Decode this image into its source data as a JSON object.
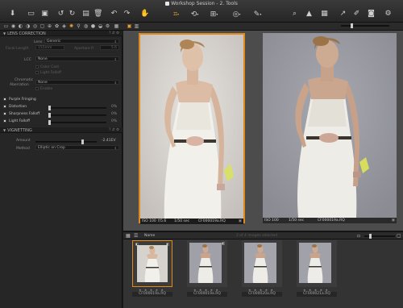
{
  "window": {
    "title": "Workshop Session - 2. Tools"
  },
  "toolbar": {
    "icons": [
      "import-icon",
      "camera-icon",
      "folder-icon",
      "rotate-left-icon",
      "rotate-right-icon",
      "copy-icon",
      "trash-icon",
      "undo-icon",
      "redo-icon",
      "hand-icon",
      "crop-icon",
      "rotate-icon",
      "keystone-icon",
      "spot-icon",
      "eyedropper-icon",
      "magnifier-icon",
      "warning-icon",
      "grid-icon",
      "cursor-icon",
      "pen-icon",
      "camera-capture-icon",
      "gear-icon"
    ]
  },
  "left_panel": {
    "lens_correction": {
      "title": "LENS CORRECTION",
      "lens_label": "Lens",
      "lens_value": "Generic",
      "focal_length_label": "Focal Length",
      "focal_length_value": "155mm",
      "aperture_label": "Aperture f/",
      "aperture_value": "5.6",
      "lcc_label": "LCC",
      "lcc_value": "None",
      "color_cast_label": "Color Cast",
      "light_falloff_sub_label": "Light Falloff",
      "chromatic_label": "Chromatic",
      "aberration_label": "Aberration",
      "chromatic_value": "None",
      "enable_label": "Enable",
      "purple_fringing_label": "Purple Fringing",
      "distortion_label": "Distortion",
      "distortion_value": "0%",
      "sharpness_falloff_label": "Sharpness Falloff",
      "sharpness_falloff_value": "0%",
      "light_falloff_label": "Light Falloff",
      "light_falloff_value": "0%"
    },
    "vignetting": {
      "title": "VIGNETTING",
      "amount_label": "Amount",
      "amount_value": "-2.41EV",
      "method_label": "Method",
      "method_value": "Elliptic on Crop"
    }
  },
  "viewer": {
    "left_caption": {
      "iso": "ISO 100",
      "aperture": "f/5.6",
      "shutter": "1/50 sec",
      "filename": "CF000019a.RQ"
    },
    "right_caption": {
      "iso": "ISO 100",
      "shutter": "1/50 sec",
      "filename": "CF000019a.RQ"
    }
  },
  "browser": {
    "sort_label": "Name",
    "selected_info": "2 of 4 images selected",
    "thumbnails": [
      {
        "filename": "CF000019a.RQ",
        "stars": "★ ★ ★ ★ ★"
      },
      {
        "filename": "CF000019a.RQ",
        "stars": "★ ★ ★ ★ ★"
      },
      {
        "filename": "CF000020a.RQ",
        "stars": "★ ★ ★ ★ ★"
      },
      {
        "filename": "CF000021a.RQ",
        "stars": "★ ★ ★ ★ ★"
      }
    ]
  },
  "colors": {
    "accent_orange": "#e08a1c",
    "panel": "#262626",
    "viewer_bg": "#4c4c4c"
  }
}
